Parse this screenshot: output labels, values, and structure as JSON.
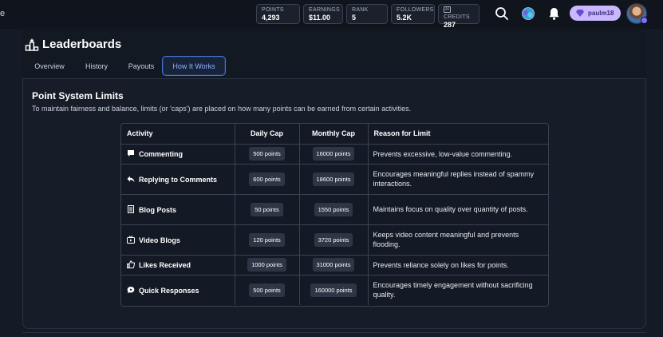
{
  "topbar": {
    "edge_char": "e",
    "stats": [
      {
        "label": "POINTS",
        "value": "4,293"
      },
      {
        "label": "EARNINGS",
        "value": "$11.00"
      },
      {
        "label": "RANK",
        "value": "5"
      },
      {
        "label": "FOLLOWERS",
        "value": "5.2K"
      },
      {
        "label": "CREDITS",
        "value": "287",
        "badge": "AI"
      }
    ],
    "username": "paulm18",
    "accent": "#c9b8ff"
  },
  "page": {
    "title": "Leaderboards",
    "tabs": [
      {
        "label": "Overview"
      },
      {
        "label": "History"
      },
      {
        "label": "Payouts"
      },
      {
        "label": "How It Works",
        "active": true
      }
    ]
  },
  "section": {
    "title": "Point System Limits",
    "description": "To maintain fairness and balance, limits (or 'caps') are placed on how many points can be earned from certain activities."
  },
  "table": {
    "headers": [
      "Activity",
      "Daily Cap",
      "Monthly Cap",
      "Reason for Limit"
    ],
    "rows": [
      {
        "icon": "comment-icon",
        "activity": "Commenting",
        "daily": "500 points",
        "monthly": "16000 points",
        "reason": "Prevents excessive, low-value commenting."
      },
      {
        "icon": "reply-icon",
        "activity": "Replying to Comments",
        "daily": "600 points",
        "monthly": "18600 points",
        "reason": "Encourages meaningful replies instead of spammy interactions."
      },
      {
        "icon": "document-icon",
        "activity": "Blog Posts",
        "daily": "50 points",
        "monthly": "1550 points",
        "reason": "Maintains focus on quality over quantity of posts."
      },
      {
        "icon": "video-icon",
        "activity": "Video Blogs",
        "daily": "120 points",
        "monthly": "3720 points",
        "reason": "Keeps video content meaningful and prevents flooding."
      },
      {
        "icon": "thumbs-up-icon",
        "activity": "Likes Received",
        "daily": "1000 points",
        "monthly": "31000 points",
        "reason": "Prevents reliance solely on likes for points."
      },
      {
        "icon": "chat-bubble-icon",
        "activity": "Quick Responses",
        "daily": "500 points",
        "monthly": "160000 points",
        "reason": "Encourages timely engagement without sacrificing quality."
      }
    ]
  }
}
